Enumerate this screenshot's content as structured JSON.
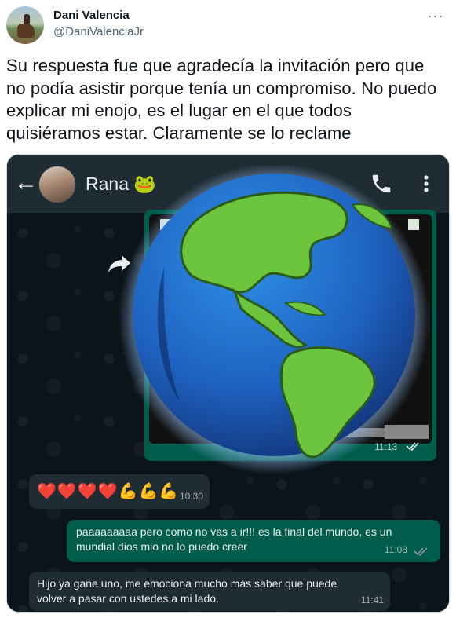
{
  "tweet": {
    "display_name": "Dani Valencia",
    "handle": "@DaniValenciaJr",
    "more_label": "···",
    "text": "Su respuesta fue que agradecía la invitación pero que no podía asistir porque tenía un compromiso. No puedo explicar mi enojo, es el lugar en el que todos quisiéramos estar. Claramente se lo reclame"
  },
  "chat": {
    "contact_name": "Rana 🐸",
    "icons": {
      "back": "back-arrow-icon",
      "call": "phone-icon",
      "menu": "kebab-menu-icon",
      "share": "forward-icon"
    },
    "image_message": {
      "time": "11:13"
    },
    "messages": [
      {
        "direction": "in",
        "text": "❤️❤️❤️❤️💪💪💪",
        "time": "10:30"
      },
      {
        "direction": "out",
        "text": "paaaaaaaaa pero como no vas a ir!!! es la final del mundo, es un mundial dios mio no lo puedo creer",
        "time": "11:08"
      },
      {
        "direction": "in",
        "text": "Hijo ya gane uno, me emociona mucho más saber que puede volver a pasar con ustedes a mi lado.",
        "time": "11:41"
      }
    ],
    "colors": {
      "header": "#1f2c33",
      "background": "#0b141a",
      "incoming": "#202c33",
      "outgoing": "#005c4b",
      "ticks": "#8696a0"
    }
  }
}
